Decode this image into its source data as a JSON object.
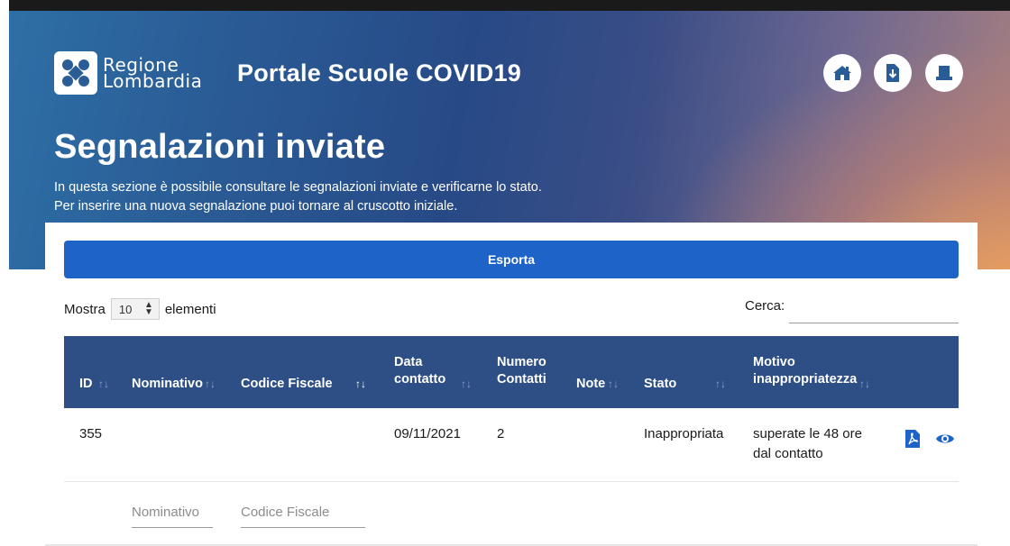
{
  "header": {
    "brand_line1": "Regione",
    "brand_line2": "Lombardia",
    "app_title": "Portale Scuole COVID19",
    "buttons": [
      {
        "icon": "home-icon"
      },
      {
        "icon": "download-icon"
      },
      {
        "icon": "logout-icon"
      }
    ]
  },
  "page": {
    "title": "Segnalazioni inviate",
    "intro_line1": "In questa sezione è possibile consultare le segnalazioni inviate e verificarne lo stato.",
    "intro_line2": "Per inserire una nuova segnalazione puoi tornare al cruscotto iniziale."
  },
  "toolbar": {
    "export_label": "Esporta",
    "show_prefix": "Mostra",
    "page_length": "10",
    "show_suffix": "elementi",
    "search_label": "Cerca:",
    "search_value": ""
  },
  "table": {
    "columns": {
      "id": "ID",
      "nominativo": "Nominativo",
      "codice_fiscale": "Codice Fiscale",
      "data_contatto_1": "Data",
      "data_contatto_2": "contatto",
      "numero_contatti_1": "Numero",
      "numero_contatti_2": "Contatti",
      "note": "Note",
      "stato": "Stato",
      "motivo_1": "Motivo",
      "motivo_2": "inappropriatezza"
    },
    "rows": [
      {
        "id": "355",
        "nominativo": "",
        "codice_fiscale": "",
        "data_contatto": "09/11/2021",
        "numero_contatti": "2",
        "note": "",
        "stato": "Inappropriata",
        "motivo_line1": "superate le 48 ore",
        "motivo_line2": "dal contatto",
        "actions": [
          "pdf-icon",
          "view-icon"
        ]
      }
    ],
    "filters": {
      "nominativo_placeholder": "Nominativo",
      "codice_fiscale_placeholder": "Codice Fiscale"
    }
  },
  "colors": {
    "primary_button": "#1e63c8",
    "table_header": "#2d4f86",
    "icon_blue": "#1e63c8"
  }
}
